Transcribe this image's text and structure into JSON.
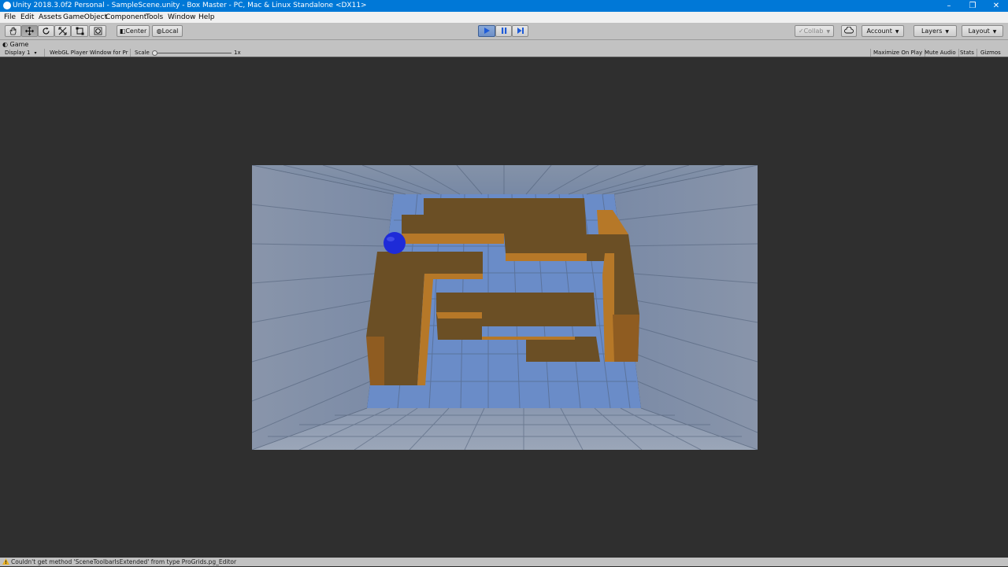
{
  "window": {
    "title": "Unity 2018.3.0f2 Personal - SampleScene.unity - Box Master - PC, Mac & Linux Standalone <DX11>",
    "minimize_glyph": "–",
    "restore_glyph": "❐",
    "close_glyph": "✕"
  },
  "menu": [
    "File",
    "Edit",
    "Assets",
    "GameObject",
    "Component",
    "Tools",
    "Window",
    "Help"
  ],
  "toolbar": {
    "tools": [
      "hand-tool",
      "move-tool",
      "rotate-tool",
      "scale-tool",
      "rect-tool",
      "transform-tool"
    ],
    "pivot": "Center",
    "space": "Local",
    "collab": "Collab",
    "account": "Account",
    "layers": "Layers",
    "layout": "Layout"
  },
  "game_view": {
    "tab": "Game",
    "display": "Display 1",
    "resolution": "WebGL Player Window for Pr",
    "scale_label": "Scale",
    "scale_value": "1x",
    "scale_fraction": 0,
    "maximize": "Maximize On Play",
    "mute": "Mute Audio",
    "stats": "Stats",
    "gizmos": "Gizmos"
  },
  "colors": {
    "accent": "#0078d7",
    "editor_bg": "#2f2f2f",
    "panel": "#c2c2c2",
    "maze_floor": "#6a8cc8",
    "maze_wall_top": "#6b4f25",
    "maze_wall_side": "#b67828",
    "ball": "#1e2bd8"
  },
  "status": {
    "message": "Couldn't get method 'SceneToolbarIsExtended' from type ProGrids.pg_Editor"
  }
}
